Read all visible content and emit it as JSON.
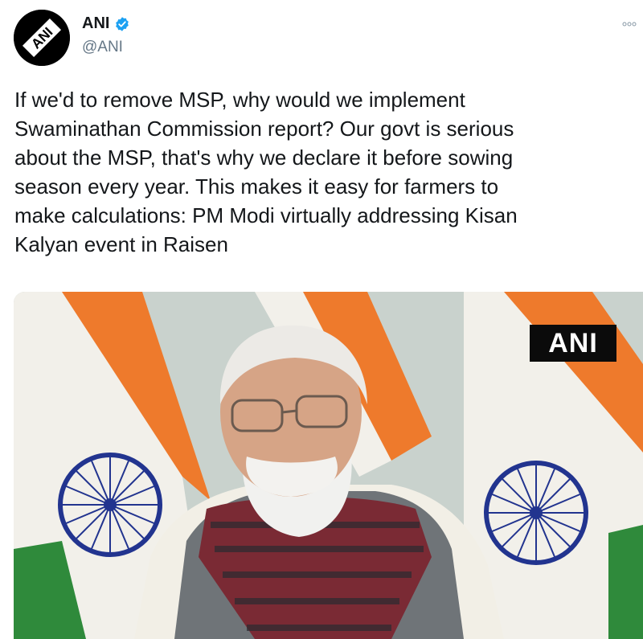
{
  "tweet": {
    "display_name": "ANI",
    "handle": "@ANI",
    "more_icon": "ellipsis-icon",
    "verified_icon": "verified-badge-icon",
    "text": "If we'd to remove MSP, why would we implement\nSwaminathan Commission report? Our govt is serious\nabout the MSP, that's why we declare it before sowing\nseason every year. This makes it easy for farmers to\nmake calculations: PM Modi virtually addressing Kisan\nKalyan event in Raisen",
    "avatar_logo": "ANI",
    "media": {
      "watermark": "ANI"
    }
  },
  "colors": {
    "verified": "#1da1f2",
    "saffron": "#f07c2a",
    "green": "#2e8b3a",
    "chakra": "#1d2f8f"
  }
}
